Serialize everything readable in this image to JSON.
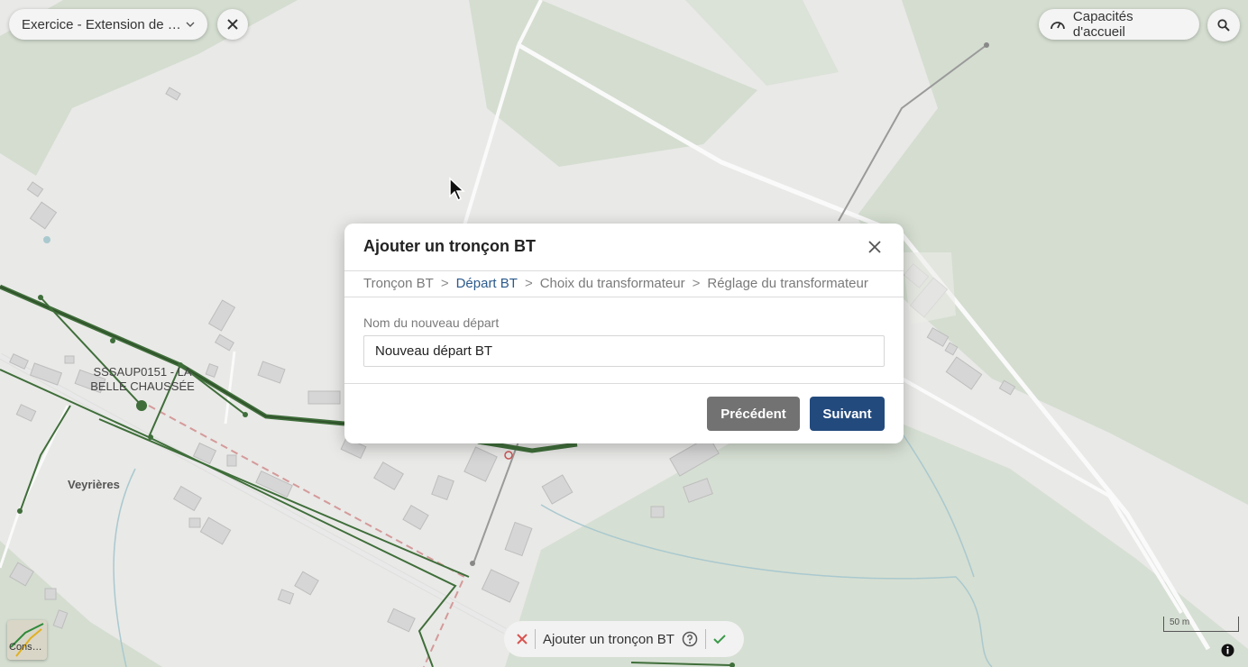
{
  "header": {
    "project_name": "Exercice - Extension de ré…",
    "capacity_label": "Capacités d'accueil"
  },
  "map": {
    "labels": {
      "substation": "SSSAUP0151 - LA BELLE CHAUSSÉE",
      "place": "Veyrières"
    },
    "scale_label": "50 m",
    "layer_label": "Cons…"
  },
  "dialog": {
    "title": "Ajouter un tronçon BT",
    "steps": [
      {
        "label": "Tronçon BT",
        "active": false
      },
      {
        "label": "Départ BT",
        "active": true
      },
      {
        "label": "Choix du transformateur",
        "active": false
      },
      {
        "label": "Réglage du transformateur",
        "active": false
      }
    ],
    "step_separator": ">",
    "field_label": "Nom du nouveau départ",
    "field_value": "Nouveau départ BT",
    "prev_label": "Précédent",
    "next_label": "Suivant"
  },
  "toolbar": {
    "label": "Ajouter un tronçon BT"
  },
  "colors": {
    "accent": "#234a7d",
    "active_step": "#2c5a8c",
    "network_line": "#3f6e3a",
    "cancel_red": "#d9534f",
    "confirm_green": "#3a9a4a"
  }
}
